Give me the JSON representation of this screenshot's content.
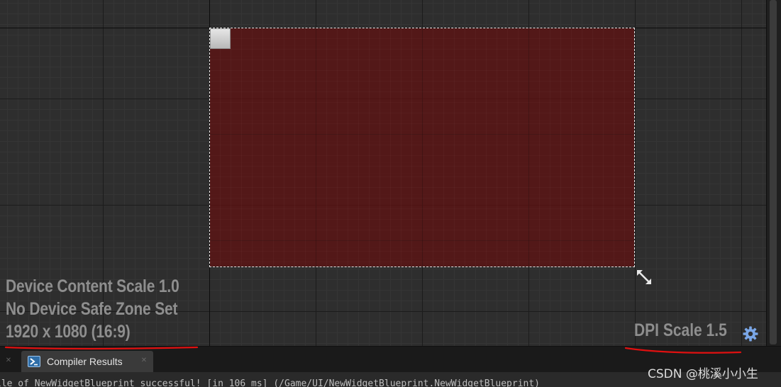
{
  "designer": {
    "info_lines": {
      "content_scale": "Device Content Scale 1.0",
      "safe_zone": "No Device Safe Zone Set",
      "resolution": "1920 x 1080 (16:9)"
    },
    "dpi_scale": "DPI Scale 1.5",
    "dpi_settings_icon": "gear-icon",
    "anchor_icon": "anchor-handle-icon",
    "resize_icon": "diagonal-resize-icon",
    "widget_color": "#601010",
    "selection_outline_color": "#e8e8e8",
    "annotation_color": "#e01010"
  },
  "bottom_panel": {
    "tab_label": "Compiler Results",
    "tab_icon": "compiler-results-icon",
    "tab_close_icon": "close-icon",
    "tab_grip_icon": "grip-icon",
    "log_text": "ile of NewWidgetBlueprint successful! [in 106 ms] (/Game/UI/NewWidgetBlueprint.NewWidgetBlueprint)"
  },
  "watermark": "CSDN @桃溪小小生"
}
